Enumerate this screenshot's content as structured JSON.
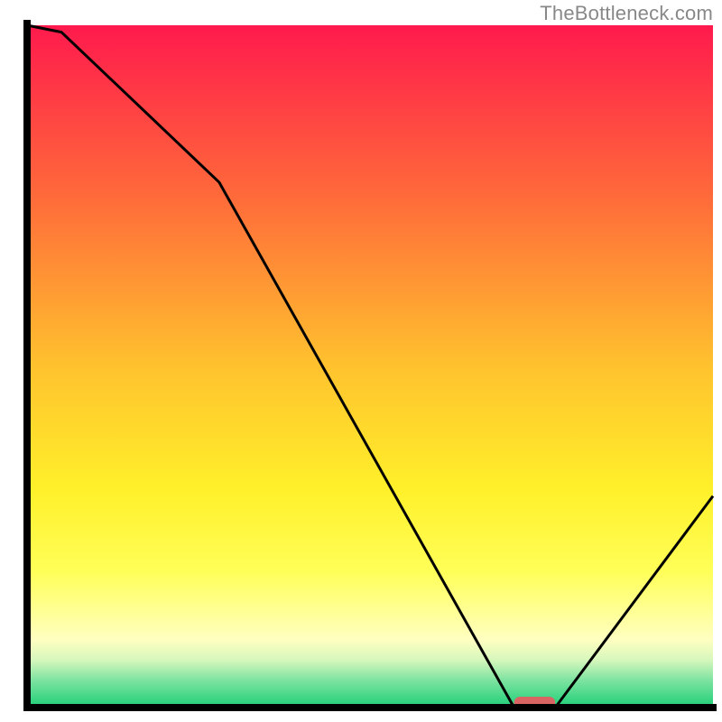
{
  "watermark": "TheBottleneck.com",
  "chart_data": {
    "type": "line",
    "title": "",
    "xlabel": "",
    "ylabel": "",
    "xlim": [
      0,
      100
    ],
    "ylim": [
      0,
      100
    ],
    "grid": false,
    "legend": false,
    "x": [
      0,
      5,
      28,
      71,
      77,
      100
    ],
    "values": [
      100,
      99,
      77,
      0,
      0,
      31
    ],
    "annotations": [],
    "marker": {
      "x_start": 71,
      "x_end": 77,
      "color": "#d96464"
    },
    "background_gradient": {
      "stops": [
        {
          "offset": 0.0,
          "color": "#ff1a4d"
        },
        {
          "offset": 0.25,
          "color": "#ff6a3a"
        },
        {
          "offset": 0.5,
          "color": "#ffc22e"
        },
        {
          "offset": 0.68,
          "color": "#fff02a"
        },
        {
          "offset": 0.8,
          "color": "#ffff58"
        },
        {
          "offset": 0.9,
          "color": "#ffffc0"
        },
        {
          "offset": 0.93,
          "color": "#d7f7bd"
        },
        {
          "offset": 0.96,
          "color": "#7de3a0"
        },
        {
          "offset": 1.0,
          "color": "#1ecf78"
        }
      ]
    },
    "axis_color": "#000000",
    "line_color": "#000000"
  }
}
